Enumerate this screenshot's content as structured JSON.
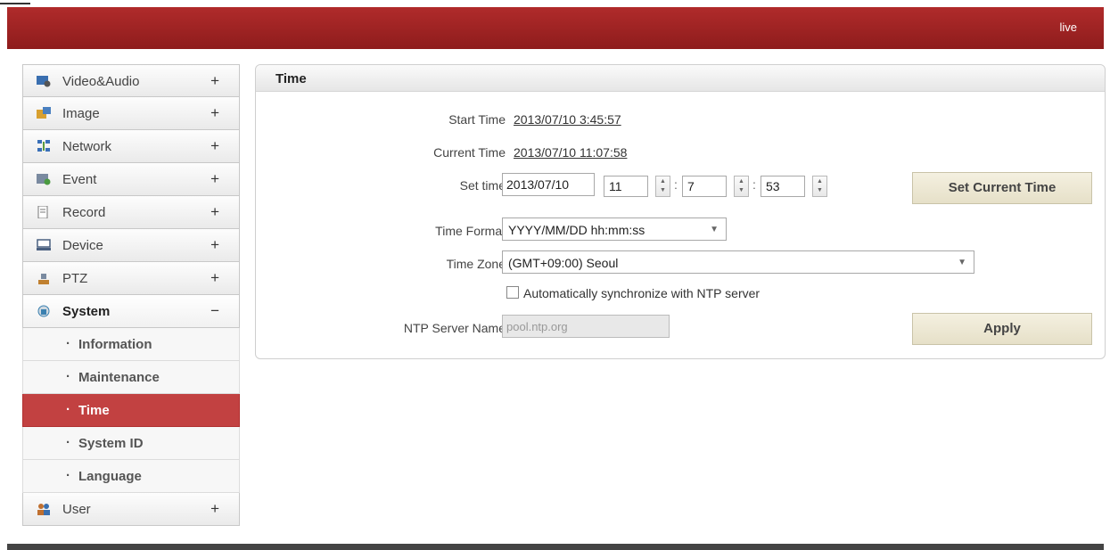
{
  "header": {
    "live_label": "live"
  },
  "sidebar": {
    "items": [
      {
        "label": "Video&Audio",
        "toggle": "+",
        "icon": "video-audio-icon",
        "icon_color": "#3a6fb0"
      },
      {
        "label": "Image",
        "toggle": "+",
        "icon": "image-icon",
        "icon_color": "#d8a030"
      },
      {
        "label": "Network",
        "toggle": "+",
        "icon": "network-icon",
        "icon_color": "#3a70b8"
      },
      {
        "label": "Event",
        "toggle": "+",
        "icon": "event-icon",
        "icon_color": "#4a8a40"
      },
      {
        "label": "Record",
        "toggle": "+",
        "icon": "record-icon",
        "icon_color": "#777777"
      },
      {
        "label": "Device",
        "toggle": "+",
        "icon": "device-icon",
        "icon_color": "#4a6080"
      },
      {
        "label": "PTZ",
        "toggle": "+",
        "icon": "ptz-icon",
        "icon_color": "#c08030"
      },
      {
        "label": "System",
        "toggle": "−",
        "icon": "system-icon",
        "icon_color": "#3a80b0"
      }
    ],
    "system_sub": [
      "Information",
      "Maintenance",
      "Time",
      "System ID",
      "Language"
    ],
    "user_item": {
      "label": "User",
      "toggle": "+",
      "icon": "user-icon",
      "icon_color": "#c07030"
    }
  },
  "panel": {
    "title": "Time",
    "start_time_label": "Start Time",
    "start_time_value": "2013/07/10 3:45:57",
    "current_time_label": "Current Time",
    "current_time_value": "2013/07/10 11:07:58",
    "set_time_label": "Set time",
    "set_date_value": "2013/07/10",
    "hour_value": "11",
    "minute_value": "7",
    "second_value": "53",
    "set_current_time_button": "Set Current Time",
    "time_format_label": "Time Format",
    "time_format_value": "YYYY/MM/DD hh:mm:ss",
    "time_zone_label": "Time Zone",
    "time_zone_value": "(GMT+09:00) Seoul",
    "ntp_sync_label": "Automatically synchronize with NTP server",
    "ntp_server_label": "NTP Server Name",
    "ntp_server_value": "pool.ntp.org",
    "apply_button": "Apply"
  },
  "colors": {
    "brand_red": "#a52323",
    "active_sub": "#c24141",
    "button_bg": "#ece6d0"
  }
}
